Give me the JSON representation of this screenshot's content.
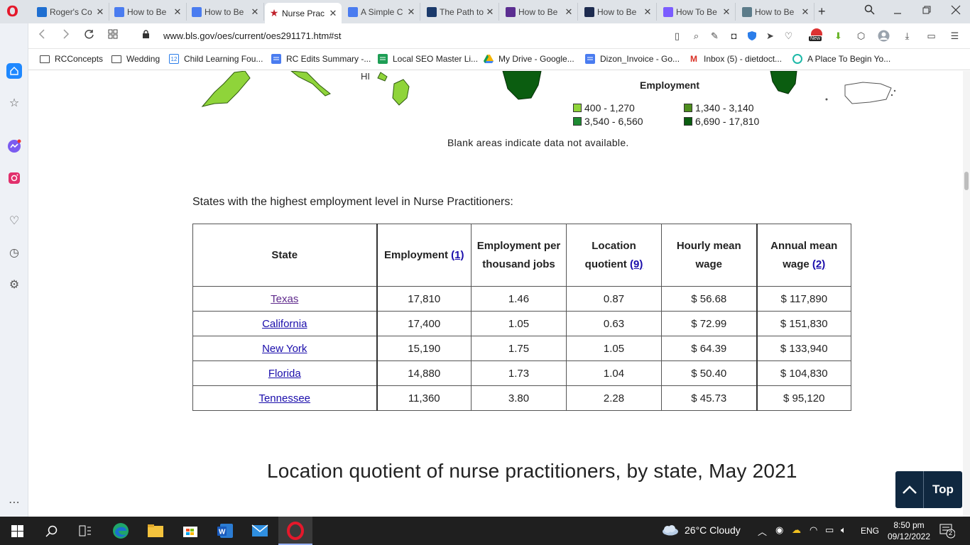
{
  "browser": {
    "tabs": [
      {
        "label": "Roger's Co",
        "favicon_color": "#1f6fd1"
      },
      {
        "label": "How to Be",
        "favicon_color": "#4a7cf0"
      },
      {
        "label": "How to Be",
        "favicon_color": "#4a7cf0"
      },
      {
        "label": "Nurse Prac",
        "favicon_color": "#c0212b",
        "active": true
      },
      {
        "label": "A Simple C",
        "favicon_color": "#4a7cf0"
      },
      {
        "label": "The Path to",
        "favicon_color": "#1b3a6b"
      },
      {
        "label": "How to Be",
        "favicon_color": "#5b2e91"
      },
      {
        "label": "How to Be",
        "favicon_color": "#1d2b4f"
      },
      {
        "label": "How To Be",
        "favicon_color": "#7b5cff"
      },
      {
        "label": "How to Be",
        "favicon_color": "#5c7c8a"
      }
    ],
    "new_tab_symbol": "+",
    "url": "www.bls.gov/oes/current/oes291171.htm#st",
    "extension_badge": "New",
    "bookmarks": [
      {
        "label": "RCConcepts",
        "icon": "folder-icon"
      },
      {
        "label": "Wedding",
        "icon": "folder-icon"
      },
      {
        "label": "Child Learning Fou...",
        "icon": "calendar-icon",
        "icon_text": "12"
      },
      {
        "label": "RC Edits Summary -...",
        "icon": "docs-icon"
      },
      {
        "label": "Local SEO Master Li...",
        "icon": "sheets-icon"
      },
      {
        "label": "My Drive - Google...",
        "icon": "drive-icon"
      },
      {
        "label": "Dizon_Invoice - Go...",
        "icon": "docs-icon"
      },
      {
        "label": "Inbox (5) - dietdoct...",
        "icon": "gmail-icon",
        "icon_text": "M"
      },
      {
        "label": "A Place To Begin Yo...",
        "icon": "site-icon"
      }
    ]
  },
  "map": {
    "hi_label": "HI",
    "legend_title": "Employment",
    "legend": [
      {
        "range": "400 - 1,270",
        "color": "#8fd43a"
      },
      {
        "range": "1,340 - 3,140",
        "color": "#4e8e1e"
      },
      {
        "range": "3,540 - 6,560",
        "color": "#1e8a32"
      },
      {
        "range": "6,690 - 17,810",
        "color": "#0b5d10"
      }
    ],
    "blank_note": "Blank areas indicate data not available."
  },
  "table": {
    "caption": "States with the highest employment level in Nurse Practitioners:",
    "headers": {
      "state": "State",
      "employment": "Employment",
      "employment_fn": "(1)",
      "per_thousand": "Employment per thousand jobs",
      "lq": "Location quotient",
      "lq_fn": "(9)",
      "hourly": "Hourly mean wage",
      "annual": "Annual mean wage",
      "annual_fn": "(2)"
    },
    "rows": [
      {
        "state": "Texas",
        "employment": "17,810",
        "per_thousand": "1.46",
        "lq": "0.87",
        "hourly": "$ 56.68",
        "annual": "$ 117,890",
        "visited": true
      },
      {
        "state": "California",
        "employment": "17,400",
        "per_thousand": "1.05",
        "lq": "0.63",
        "hourly": "$ 72.99",
        "annual": "$ 151,830"
      },
      {
        "state": "New York",
        "employment": "15,190",
        "per_thousand": "1.75",
        "lq": "1.05",
        "hourly": "$ 64.39",
        "annual": "$ 133,940"
      },
      {
        "state": "Florida",
        "employment": "14,880",
        "per_thousand": "1.73",
        "lq": "1.04",
        "hourly": "$ 50.40",
        "annual": "$ 104,830"
      },
      {
        "state": "Tennessee",
        "employment": "11,360",
        "per_thousand": "3.80",
        "lq": "2.28",
        "hourly": "$ 45.73",
        "annual": "$ 95,120"
      }
    ]
  },
  "lq_heading": "Location quotient of nurse practitioners, by state, May 2021",
  "top_button": "Top",
  "taskbar": {
    "weather": "26°C  Cloudy",
    "lang": "ENG",
    "time": "8:50 pm",
    "date": "09/12/2022",
    "notifications": "2"
  }
}
